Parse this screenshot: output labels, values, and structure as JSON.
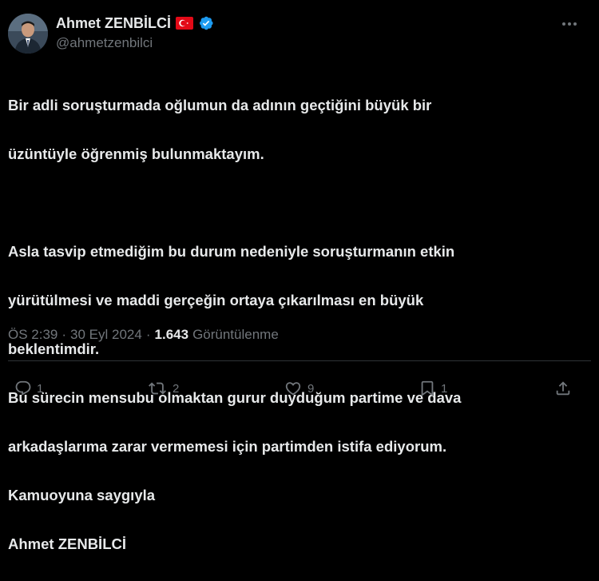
{
  "author": {
    "display_name": "Ahmet ZENBİLCİ",
    "handle": "@ahmetzenbilci",
    "flag_icon": "turkey-flag-icon",
    "verified_icon": "verified-badge-icon"
  },
  "tweet": {
    "lines": [
      "Bir adli soruşturmada oğlumun da adının geçtiğini büyük bir",
      "üzüntüyle öğrenmiş bulunmaktayım.",
      "",
      "Asla tasvip etmediğim bu durum nedeniyle soruşturmanın etkin",
      "yürütülmesi ve maddi gerçeğin ortaya çıkarılması en büyük",
      "beklentimdir.",
      "Bu sürecin mensubu olmaktan gurur duyduğum partime ve dava",
      "arkadaşlarıma zarar vermemesi için partimden istifa ediyorum.",
      "Kamuoyuna saygıyla",
      "Ahmet ZENBİLCİ"
    ]
  },
  "meta": {
    "time": "ÖS 2:39",
    "separator": "·",
    "date": "30 Eyl 2024",
    "views_count": "1.643",
    "views_label": "Görüntülenme"
  },
  "actions": {
    "reply_count": "1",
    "retweet_count": "2",
    "like_count": "9",
    "bookmark_count": "1"
  },
  "colors": {
    "background": "#000000",
    "text_primary": "#e7e9ea",
    "text_secondary": "#71767b",
    "verified_blue": "#1d9bf0",
    "flag_red": "#e30a17"
  }
}
